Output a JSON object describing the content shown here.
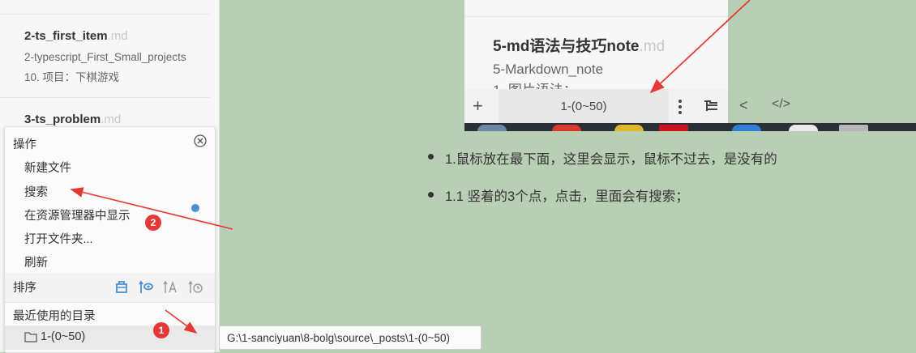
{
  "file_list": {
    "items": [
      {
        "name": "2-ts_first_item",
        "ext": ".md",
        "subtitle": "2-typescript_First_Small_projects",
        "line2": "10. 项目：下棋游戏"
      },
      {
        "name": "3-ts_problem",
        "ext": ".md"
      }
    ]
  },
  "operations_panel": {
    "title": "操作",
    "items": [
      "新建文件",
      "搜索",
      "在资源管理器中显示",
      "打开文件夹...",
      "刷新"
    ],
    "sort": {
      "label": "排序",
      "icons": [
        "sort-by-type-icon",
        "sort-by-visit-icon",
        "sort-by-name-icon",
        "sort-by-time-icon"
      ]
    },
    "recent": {
      "label": "最近使用的目录",
      "folder": "1-(0~50)"
    }
  },
  "tooltip": {
    "path": "G:\\1-sanciyuan\\8-bolg\\source\\_posts\\1-(0~50)"
  },
  "badges": {
    "one": "1",
    "two": "2"
  },
  "inset": {
    "card_title": "5-md语法与技巧note",
    "card_ext": ".md",
    "card_subtitle": "5-Markdown_note",
    "card_line2": "1. 图片语法：",
    "plus": "+",
    "folder_name": "1-(0~50)",
    "prev": "<",
    "code": "</>"
  },
  "notes": [
    "1.鼠标放在最下面，这里会显示，鼠标不过去，是没有的",
    "1.1 竖着的3个点，点击，里面会有搜索；"
  ],
  "colors": {
    "background": "#b9cfb5",
    "annotation_red": "#e53935",
    "accent_blue": "#4a8fd6"
  }
}
